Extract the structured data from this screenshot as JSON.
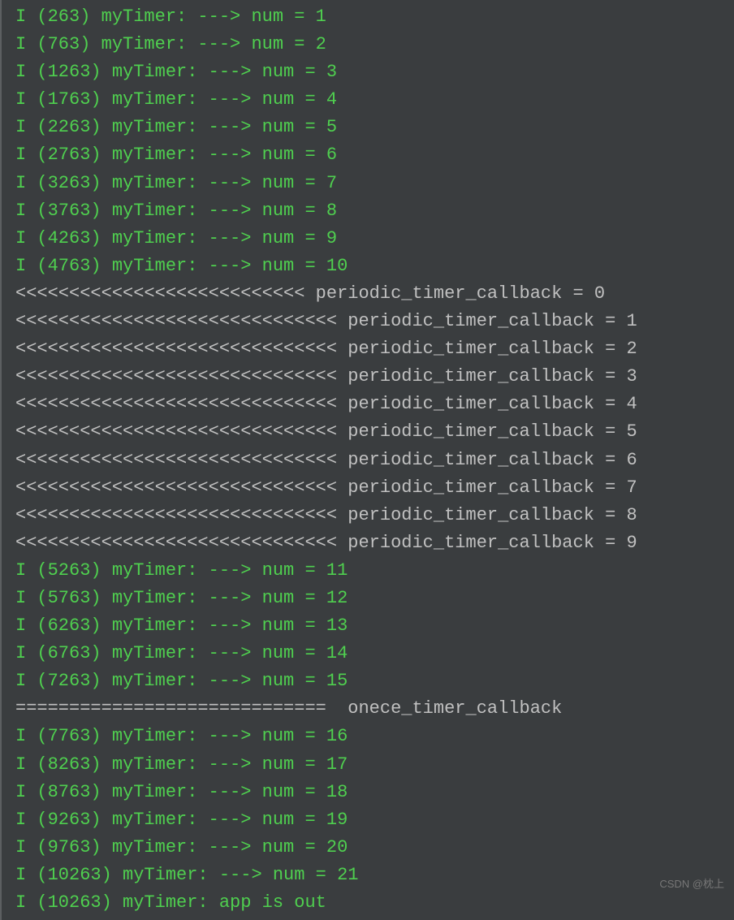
{
  "watermark": "CSDN @枕上",
  "lines": [
    {
      "cls": "green",
      "text": "I (263) myTimer: ---> num = 1"
    },
    {
      "cls": "green",
      "text": "I (763) myTimer: ---> num = 2"
    },
    {
      "cls": "green",
      "text": "I (1263) myTimer: ---> num = 3"
    },
    {
      "cls": "green",
      "text": "I (1763) myTimer: ---> num = 4"
    },
    {
      "cls": "green",
      "text": "I (2263) myTimer: ---> num = 5"
    },
    {
      "cls": "green",
      "text": "I (2763) myTimer: ---> num = 6"
    },
    {
      "cls": "green",
      "text": "I (3263) myTimer: ---> num = 7"
    },
    {
      "cls": "green",
      "text": "I (3763) myTimer: ---> num = 8"
    },
    {
      "cls": "green",
      "text": "I (4263) myTimer: ---> num = 9"
    },
    {
      "cls": "green",
      "text": "I (4763) myTimer: ---> num = 10"
    },
    {
      "cls": "gray",
      "text": "<<<<<<<<<<<<<<<<<<<<<<<<<<< periodic_timer_callback = 0"
    },
    {
      "cls": "gray",
      "text": "<<<<<<<<<<<<<<<<<<<<<<<<<<<<<< periodic_timer_callback = 1"
    },
    {
      "cls": "gray",
      "text": "<<<<<<<<<<<<<<<<<<<<<<<<<<<<<< periodic_timer_callback = 2"
    },
    {
      "cls": "gray",
      "text": "<<<<<<<<<<<<<<<<<<<<<<<<<<<<<< periodic_timer_callback = 3"
    },
    {
      "cls": "gray",
      "text": "<<<<<<<<<<<<<<<<<<<<<<<<<<<<<< periodic_timer_callback = 4"
    },
    {
      "cls": "gray",
      "text": "<<<<<<<<<<<<<<<<<<<<<<<<<<<<<< periodic_timer_callback = 5"
    },
    {
      "cls": "gray",
      "text": "<<<<<<<<<<<<<<<<<<<<<<<<<<<<<< periodic_timer_callback = 6"
    },
    {
      "cls": "gray",
      "text": "<<<<<<<<<<<<<<<<<<<<<<<<<<<<<< periodic_timer_callback = 7"
    },
    {
      "cls": "gray",
      "text": "<<<<<<<<<<<<<<<<<<<<<<<<<<<<<< periodic_timer_callback = 8"
    },
    {
      "cls": "gray",
      "text": "<<<<<<<<<<<<<<<<<<<<<<<<<<<<<< periodic_timer_callback = 9"
    },
    {
      "cls": "green",
      "text": "I (5263) myTimer: ---> num = 11"
    },
    {
      "cls": "green",
      "text": "I (5763) myTimer: ---> num = 12"
    },
    {
      "cls": "green",
      "text": "I (6263) myTimer: ---> num = 13"
    },
    {
      "cls": "green",
      "text": "I (6763) myTimer: ---> num = 14"
    },
    {
      "cls": "green",
      "text": "I (7263) myTimer: ---> num = 15"
    },
    {
      "cls": "gray",
      "text": "=============================  onece_timer_callback"
    },
    {
      "cls": "green",
      "text": "I (7763) myTimer: ---> num = 16"
    },
    {
      "cls": "green",
      "text": "I (8263) myTimer: ---> num = 17"
    },
    {
      "cls": "green",
      "text": "I (8763) myTimer: ---> num = 18"
    },
    {
      "cls": "green",
      "text": "I (9263) myTimer: ---> num = 19"
    },
    {
      "cls": "green",
      "text": "I (9763) myTimer: ---> num = 20"
    },
    {
      "cls": "green",
      "text": "I (10263) myTimer: ---> num = 21"
    },
    {
      "cls": "green",
      "text": "I (10263) myTimer: app is out"
    }
  ]
}
